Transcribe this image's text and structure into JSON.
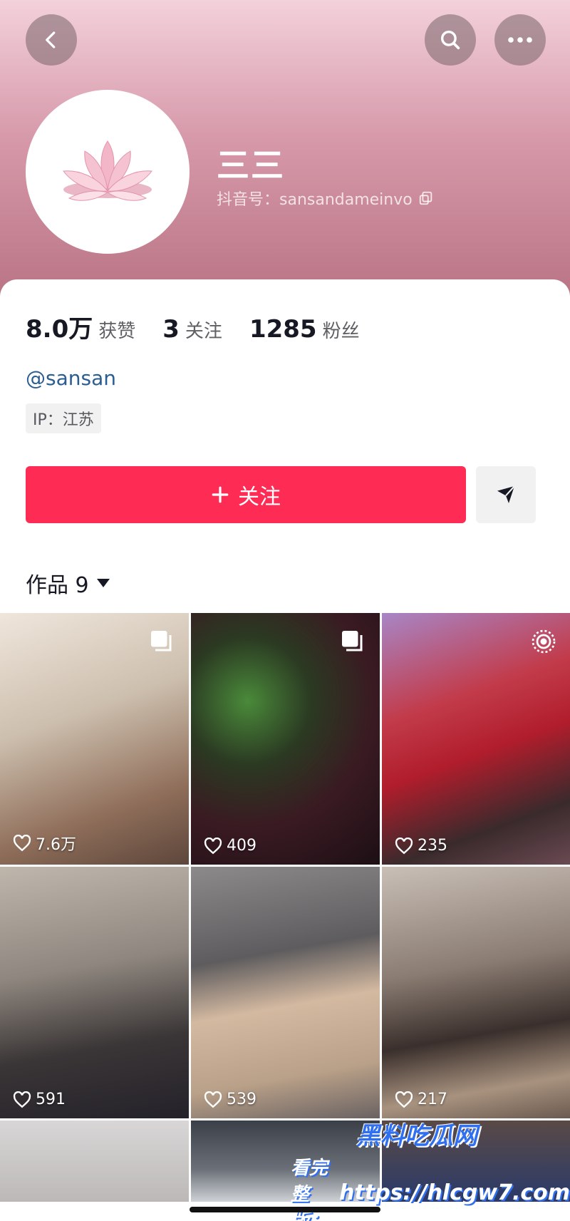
{
  "profile": {
    "nickname": "三三",
    "douyin_id_label": "抖音号：sansandameinvo",
    "handle": "@sansan",
    "ip_label": "IP：江苏"
  },
  "stats": [
    {
      "value": "8.0万",
      "label": "获赞"
    },
    {
      "value": "3",
      "label": "关注"
    },
    {
      "value": "1285",
      "label": "粉丝"
    }
  ],
  "actions": {
    "follow_label": "关注"
  },
  "works": {
    "label": "作品 9",
    "items": [
      {
        "likes": "7.6万",
        "badge": "multi-image-icon"
      },
      {
        "likes": "409",
        "badge": "multi-image-icon"
      },
      {
        "likes": "235",
        "badge": "live-photo-icon"
      },
      {
        "likes": "591",
        "badge": ""
      },
      {
        "likes": "539",
        "badge": ""
      },
      {
        "likes": "217",
        "badge": ""
      },
      {
        "likes": "",
        "badge": ""
      },
      {
        "likes": "",
        "badge": ""
      },
      {
        "likes": "",
        "badge": ""
      }
    ]
  },
  "watermark": {
    "title": "黑料吃瓜网",
    "lead": "看完整版：",
    "url": "https://hlcgw7.com"
  },
  "colors": {
    "accent": "#fe2c55",
    "header_top": "#f3d1db",
    "header_bottom": "#b97484",
    "handle": "#2a5d91"
  }
}
